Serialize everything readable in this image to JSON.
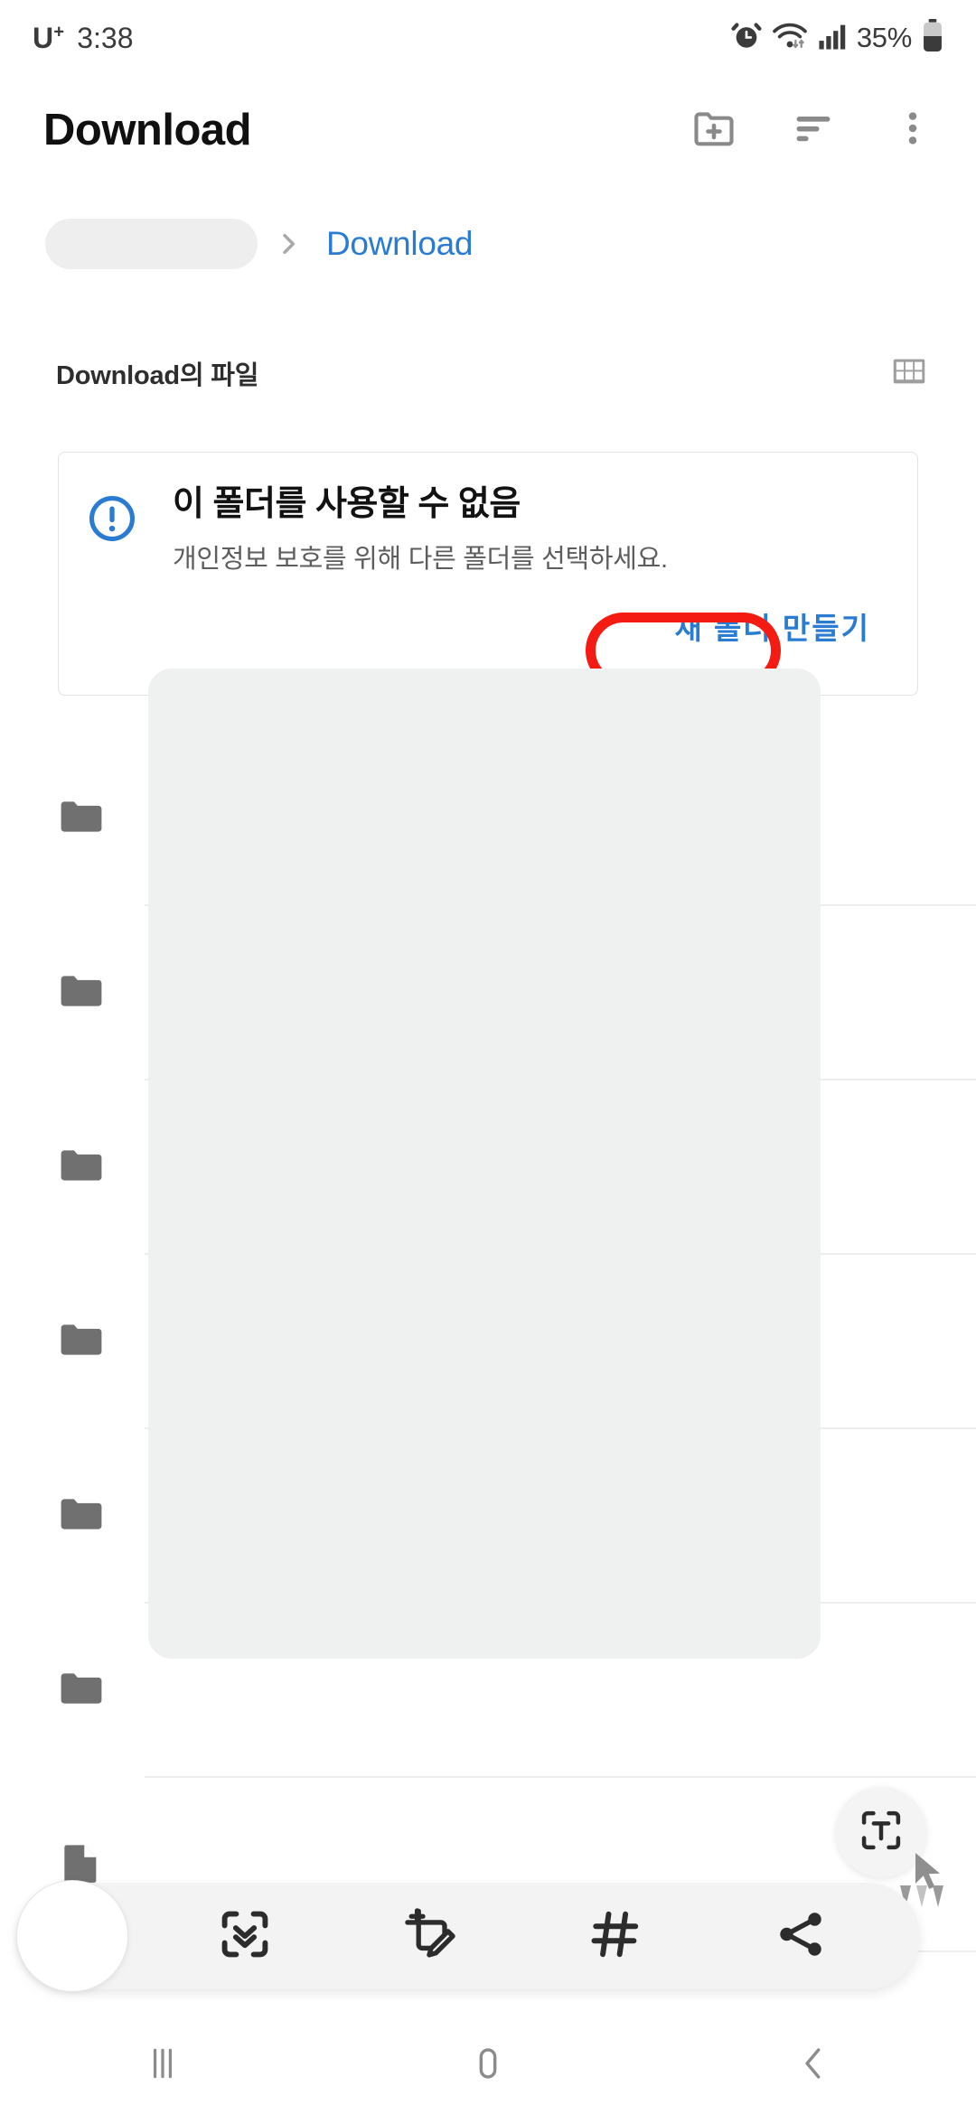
{
  "status_bar": {
    "carrier": "U",
    "carrier_sup": "+",
    "time": "3:38",
    "battery_percent": "35%",
    "icons": [
      "alarm-icon",
      "wifi-icon",
      "signal-icon",
      "battery-icon"
    ]
  },
  "app_bar": {
    "title": "Download",
    "actions": [
      {
        "name": "new-folder-icon",
        "label": "새 폴더"
      },
      {
        "name": "sort-icon",
        "label": "정렬"
      },
      {
        "name": "more-options-icon",
        "label": "더보기"
      }
    ]
  },
  "breadcrumb": {
    "root_redacted": "",
    "separator": "›",
    "current": "Download"
  },
  "section": {
    "title": "Download의 파일",
    "view_toggle_icon": "grid-view-icon"
  },
  "warning_card": {
    "icon": "info-circle-icon",
    "title": "이 폴더를 사용할 수 없음",
    "description": "개인정보 보호를 위해 다른 폴더를 선택하세요.",
    "action_label": "새 폴더 만들기",
    "annotation_color": "#f41c12",
    "accent_color": "#2a7cd2"
  },
  "file_list": {
    "redacted": true,
    "items": [
      {
        "icon": "folder-icon",
        "name": "",
        "meta": ""
      },
      {
        "icon": "folder-icon",
        "name": "",
        "meta": ""
      },
      {
        "icon": "folder-icon",
        "name": "",
        "meta": ""
      },
      {
        "icon": "folder-icon",
        "name": "",
        "meta": ""
      },
      {
        "icon": "folder-icon",
        "name": "",
        "meta": ""
      },
      {
        "icon": "folder-icon",
        "name": "",
        "meta": ""
      },
      {
        "icon": "file-icon",
        "name": "",
        "meta": ""
      }
    ]
  },
  "text_extract_fab": {
    "icon": "text-extract-icon"
  },
  "screenshot_toolbar": {
    "thumb": "capture-preview-thumbnail",
    "buttons": [
      {
        "name": "scroll-capture-icon",
        "label": "스크롤 캡처"
      },
      {
        "name": "crop-edit-icon",
        "label": "그리기"
      },
      {
        "name": "tag-icon",
        "label": "태그"
      },
      {
        "name": "share-icon",
        "label": "공유"
      }
    ]
  },
  "nav_bar": {
    "buttons": [
      {
        "name": "recents-icon",
        "label": "최근 앱"
      },
      {
        "name": "home-icon",
        "label": "홈"
      },
      {
        "name": "back-icon",
        "label": "뒤로"
      }
    ]
  }
}
